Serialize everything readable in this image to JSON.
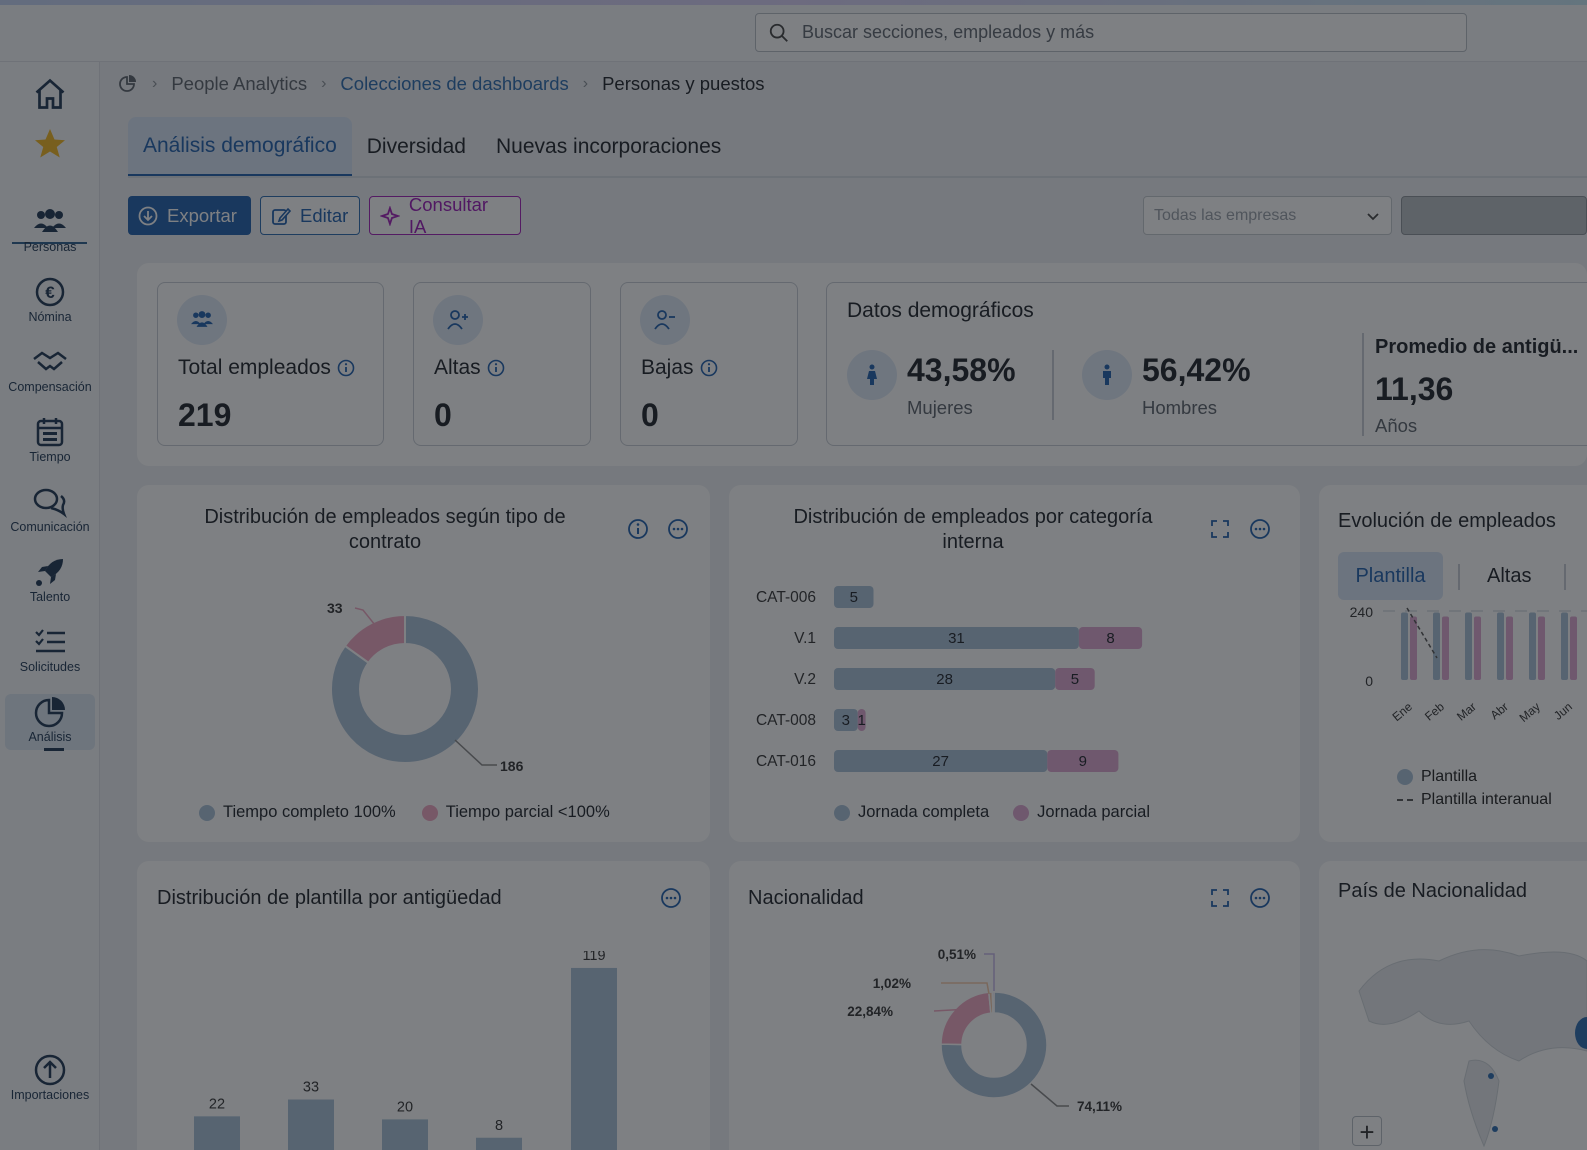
{
  "search": {
    "placeholder": "Buscar secciones, empleados y más"
  },
  "sidebar": {
    "items": [
      {
        "label": "Personas"
      },
      {
        "label": "Nómina"
      },
      {
        "label": "Compensación"
      },
      {
        "label": "Tiempo"
      },
      {
        "label": "Comunicación"
      },
      {
        "label": "Talento"
      },
      {
        "label": "Solicitudes"
      },
      {
        "label": "Análisis"
      },
      {
        "label": "Importaciones"
      }
    ]
  },
  "breadcrumb": {
    "items": [
      "People Analytics",
      "Colecciones de dashboards",
      "Personas y puestos"
    ]
  },
  "tabs": [
    "Análisis demográfico",
    "Diversidad",
    "Nuevas incorporaciones"
  ],
  "toolbar": {
    "export": "Exportar",
    "edit": "Editar",
    "ai": "Consultar IA",
    "company_select": "Todas las empresas"
  },
  "kpis": [
    {
      "label": "Total empleados",
      "value": "219"
    },
    {
      "label": "Altas",
      "value": "0"
    },
    {
      "label": "Bajas",
      "value": "0"
    }
  ],
  "demographics": {
    "title": "Datos demográficos",
    "women_pct": "43,58%",
    "women_label": "Mujeres",
    "men_pct": "56,42%",
    "men_label": "Hombres",
    "tenure_title": "Promedio de antigü...",
    "tenure_value": "11,36",
    "tenure_unit": "Años"
  },
  "cards": {
    "contract_title": "Distribución de empleados según tipo de contrato",
    "category_title": "Distribución de empleados por categoría interna",
    "evolution_title": "Evolución de empleados",
    "evolution_tabs": [
      "Plantilla",
      "Altas"
    ],
    "evolution_legend": [
      "Plantilla",
      "Plantilla interanual"
    ],
    "seniority_title": "Distribución de plantilla por antigüedad",
    "nationality_title": "Nacionalidad",
    "country_title": "País de Nacionalidad"
  },
  "colors": {
    "primary": "#1f5fad",
    "full_time": "#a9c0d8",
    "part_time": "#dda6d1",
    "bar": "#a9c0d8",
    "ai": "#a321b9"
  },
  "chart_data": [
    {
      "type": "pie",
      "title": "Distribución de empleados según tipo de contrato",
      "labels": [
        "Tiempo completo 100%",
        "Tiempo parcial <100%"
      ],
      "values": [
        186,
        33
      ],
      "display": [
        "186",
        "33"
      ]
    },
    {
      "type": "bar",
      "title": "Distribución de empleados por categoría interna",
      "orientation": "horizontal",
      "stacked": true,
      "categories": [
        "CAT-006",
        "V.1",
        "V.2",
        "CAT-008",
        "CAT-016"
      ],
      "series": [
        {
          "name": "Jornada completa",
          "values": [
            5,
            31,
            28,
            3,
            27
          ]
        },
        {
          "name": "Jornada parcial",
          "values": [
            0,
            8,
            5,
            1,
            9
          ]
        }
      ],
      "display": [
        [
          "5",
          ""
        ],
        [
          "31",
          "8"
        ],
        [
          "28",
          "5"
        ],
        [
          "3",
          "1"
        ],
        [
          "27",
          "9"
        ]
      ]
    },
    {
      "type": "bar",
      "title": "Evolución de empleados",
      "categories": [
        "Ene",
        "Feb",
        "Mar",
        "Abr",
        "May",
        "Jun"
      ],
      "ylim": [
        0,
        240
      ],
      "yticks": [
        "0",
        "240"
      ],
      "series": [
        {
          "name": "Plantilla",
          "values": [
            219,
            219,
            219,
            219,
            219,
            219
          ]
        },
        {
          "name": "Plantilla interanual",
          "values": [
            200,
            190,
            null,
            null,
            null,
            null
          ]
        }
      ]
    },
    {
      "type": "bar",
      "title": "Distribución de plantilla por antigüedad",
      "values": [
        22,
        33,
        20,
        8,
        119
      ],
      "labels": [
        "22",
        "33",
        "20",
        "8",
        "119"
      ]
    },
    {
      "type": "pie",
      "title": "Nacionalidad",
      "values": [
        74.11,
        22.84,
        1.02,
        0.51
      ],
      "labels": [
        "74,11%",
        "22,84%",
        "1,02%",
        "0,51%"
      ]
    }
  ]
}
